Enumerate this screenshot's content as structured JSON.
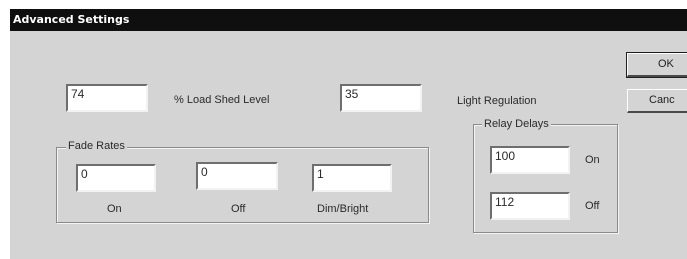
{
  "window": {
    "title": "Advanced Settings"
  },
  "load_shed": {
    "value": "74",
    "label": "% Load Shed Level"
  },
  "light_regulation": {
    "value": "35",
    "label": "Light Regulation"
  },
  "fade_rates": {
    "title": "Fade Rates",
    "on": {
      "value": "0",
      "label": "On"
    },
    "off": {
      "value": "0",
      "label": "Off"
    },
    "dim_bright": {
      "value": "1",
      "label": "Dim/Bright"
    }
  },
  "relay_delays": {
    "title": "Relay Delays",
    "on": {
      "value": "100",
      "label": "On"
    },
    "off": {
      "value": "112",
      "label": "Off"
    }
  },
  "buttons": {
    "ok": "OK",
    "cancel": "Canc"
  }
}
